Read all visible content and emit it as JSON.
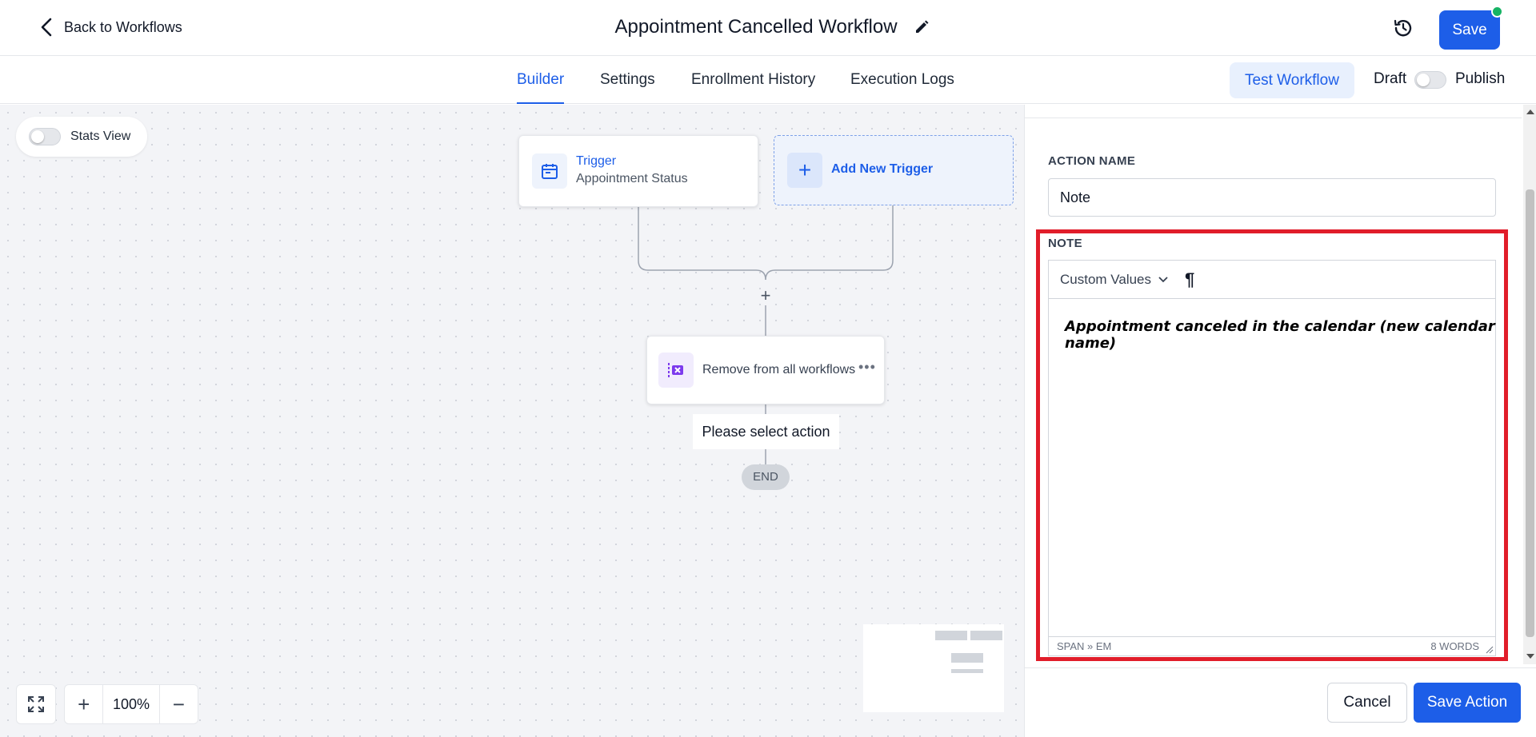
{
  "header": {
    "back_label": "Back to Workflows",
    "title": "Appointment Cancelled Workflow",
    "save_label": "Save"
  },
  "tabs": [
    {
      "label": "Builder",
      "active": true
    },
    {
      "label": "Settings",
      "active": false
    },
    {
      "label": "Enrollment History",
      "active": false
    },
    {
      "label": "Execution Logs",
      "active": false
    }
  ],
  "tabs_right": {
    "test_workflow": "Test Workflow",
    "draft_label": "Draft",
    "publish_label": "Publish",
    "published": false
  },
  "canvas": {
    "stats_view_label": "Stats View",
    "stats_view_on": false,
    "trigger": {
      "title": "Trigger",
      "subtitle": "Appointment Status"
    },
    "add_trigger_label": "Add New Trigger",
    "action_node_label": "Remove from all workflows",
    "please_select": "Please select action",
    "end_label": "END",
    "zoom": "100%"
  },
  "panel": {
    "action_name_label": "ACTION NAME",
    "action_name_value": "Note",
    "note_label": "NOTE",
    "custom_values_label": "Custom Values",
    "pilcrow": "¶",
    "note_body": "Appointment canceled in the calendar (new calendar name)",
    "status_path": "SPAN » EM",
    "word_count": "8 WORDS",
    "cancel_label": "Cancel",
    "save_action_label": "Save Action"
  },
  "colors": {
    "accent": "#1d5ee8",
    "highlight": "#e11d2a",
    "online": "#16b364"
  }
}
